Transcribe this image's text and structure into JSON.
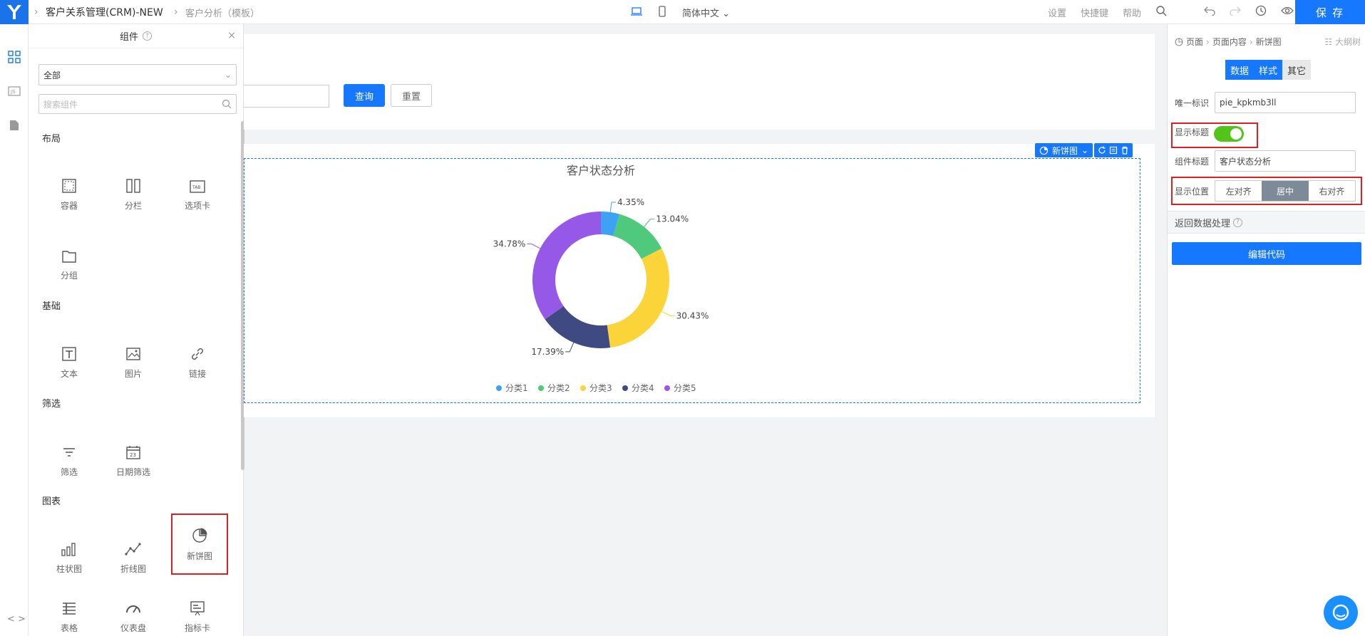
{
  "app": {
    "breadcrumb": [
      "客户关系管理(CRM)-NEW",
      "客户分析（模板）"
    ],
    "language": "简体中文",
    "menu": [
      "设置",
      "快捷键",
      "帮助"
    ],
    "save_label": "保 存"
  },
  "component_panel": {
    "title": "组件",
    "filter_value": "全部",
    "search_placeholder": "搜索组件",
    "sections": [
      {
        "title": "布局",
        "items": [
          {
            "label": "容器",
            "icon": "container-icon"
          },
          {
            "label": "分栏",
            "icon": "columns-icon"
          },
          {
            "label": "选项卡",
            "icon": "tabs-icon"
          },
          {
            "label": "分组",
            "icon": "group-icon"
          }
        ]
      },
      {
        "title": "基础",
        "items": [
          {
            "label": "文本",
            "icon": "text-icon"
          },
          {
            "label": "图片",
            "icon": "image-icon"
          },
          {
            "label": "链接",
            "icon": "link-icon"
          }
        ]
      },
      {
        "title": "筛选",
        "items": [
          {
            "label": "筛选",
            "icon": "filter-icon"
          },
          {
            "label": "日期筛选",
            "icon": "calendar-icon"
          }
        ]
      },
      {
        "title": "图表",
        "items": [
          {
            "label": "柱状图",
            "icon": "bar-chart-icon"
          },
          {
            "label": "折线图",
            "icon": "line-chart-icon"
          },
          {
            "label": "新饼图",
            "icon": "pie-chart-icon",
            "selected": true
          },
          {
            "label": "表格",
            "icon": "table-icon"
          },
          {
            "label": "仪表盘",
            "icon": "gauge-icon"
          },
          {
            "label": "指标卡",
            "icon": "indicator-card-icon"
          }
        ]
      }
    ]
  },
  "canvas": {
    "query_label": "查询",
    "reset_label": "重置",
    "selected_component": "新饼图"
  },
  "chart_data": {
    "type": "pie",
    "donut": true,
    "title": "客户状态分析",
    "categories": [
      "分类1",
      "分类2",
      "分类3",
      "分类4",
      "分类5"
    ],
    "values": [
      4.35,
      13.04,
      30.43,
      17.39,
      34.78
    ],
    "labels": [
      "4.35%",
      "13.04%",
      "30.43%",
      "17.39%",
      "34.78%"
    ],
    "colors": [
      "#3fa1f4",
      "#4fc97c",
      "#fbd43a",
      "#3f4a82",
      "#9658e6"
    ],
    "legend": "bottom"
  },
  "props_panel": {
    "breadcrumb": [
      "页面",
      "页面内容",
      "新饼图"
    ],
    "outline_label": "大纲树",
    "tabs": [
      "数据",
      "样式",
      "其它"
    ],
    "active_tab": "数据",
    "id_label": "唯一标识",
    "id_value": "pie_kpkmb3ll",
    "show_title_label": "显示标题",
    "show_title": true,
    "component_title_label": "组件标题",
    "component_title_value": "客户状态分析",
    "position_label": "显示位置",
    "position_options": [
      "左对齐",
      "居中",
      "右对齐"
    ],
    "position_selected": "居中",
    "data_processing_label": "返回数据处理",
    "edit_code_label": "编辑代码"
  }
}
